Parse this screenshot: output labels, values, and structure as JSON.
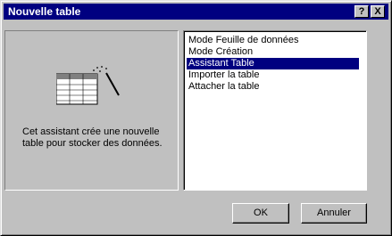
{
  "window": {
    "title": "Nouvelle table",
    "help_label": "?",
    "close_label": "X"
  },
  "description": "Cet assistant crée une nouvelle table pour stocker des données.",
  "list": {
    "items": [
      "Mode Feuille de données",
      "Mode Création",
      "Assistant Table",
      "Importer la table",
      "Attacher la table"
    ],
    "selected": "Assistant Table"
  },
  "buttons": {
    "ok": "OK",
    "cancel": "Annuler"
  },
  "colors": {
    "titlebar": "#000080",
    "face": "#c0c0c0",
    "selection": "#000080"
  },
  "icons": {
    "illustration": "table-wizard-icon"
  }
}
